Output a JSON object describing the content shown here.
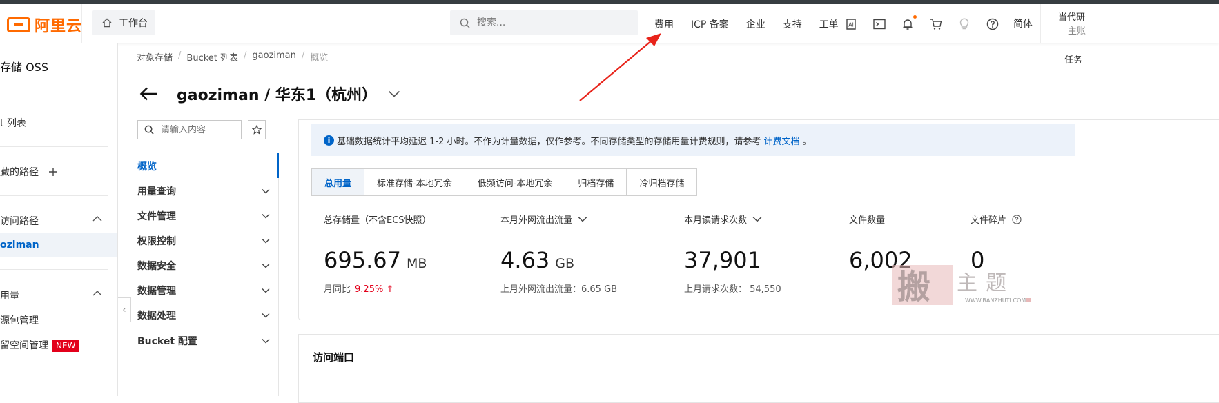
{
  "header": {
    "logo_text": "阿里云",
    "workbench_label": "工作台",
    "search_placeholder": "搜索...",
    "nav_links": [
      "费用",
      "ICP 备案",
      "企业",
      "支持",
      "工单"
    ],
    "icons": [
      "ai-icon",
      "terminal-icon",
      "bell-icon",
      "cart-icon",
      "lightbulb-icon",
      "help-icon"
    ],
    "language": "简体",
    "account_line1": "当代研",
    "account_line2": "主账"
  },
  "sidebar": {
    "title": "存储 OSS",
    "items": {
      "bucket_list": "t 列表",
      "fav_path": "藏的路径",
      "access_path": "访问路径",
      "gaoziman": "oziman",
      "usage": "用量",
      "resource_pack": "源包管理",
      "reserved_space": "留空间管理",
      "new_badge": "NEW"
    }
  },
  "breadcrumb": [
    "对象存储",
    "Bucket 列表",
    "gaoziman",
    "概览"
  ],
  "task_label": "任务",
  "page_title": "gaoziman / 华东1（杭州）",
  "subnav": {
    "search_placeholder": "请输入内容",
    "items": [
      "概览",
      "用量查询",
      "文件管理",
      "权限控制",
      "数据安全",
      "数据管理",
      "数据处理",
      "Bucket 配置"
    ]
  },
  "notice": {
    "text": "基础数据统计平均延迟 1-2 小时。不作为计量数据，仅作参考。不同存储类型的存储用量计费规则，请参考",
    "link": "计费文档",
    "tail": " 。"
  },
  "tabs": [
    "总用量",
    "标准存储-本地冗余",
    "低频访问-本地冗余",
    "归档存储",
    "冷归档存储"
  ],
  "metrics": [
    {
      "label": "总存储量（不含ECS快照）",
      "value": "695.67",
      "unit": "MB",
      "sub_label": "月同比",
      "sub_value": "9.25% ↑"
    },
    {
      "label": "本月外网流出流量",
      "value": "4.63",
      "unit": "GB",
      "sub_label": "上月外网流出流量：6.65 GB"
    },
    {
      "label": "本月读请求次数",
      "value": "37,901",
      "unit": "",
      "sub_label": "上月请求次数：  54,550"
    },
    {
      "label": "文件数量",
      "value": "6,002",
      "unit": ""
    },
    {
      "label": "文件碎片",
      "value": "0",
      "unit": ""
    }
  ],
  "card2_title": "访问端口",
  "watermark": {
    "text": "搬主题",
    "url": "WWW.BANZHUTI.COM"
  },
  "colors": {
    "accent": "#0064c8",
    "brand": "#ff6a00",
    "alert": "#e3001b",
    "arrow": "#e8231a"
  }
}
